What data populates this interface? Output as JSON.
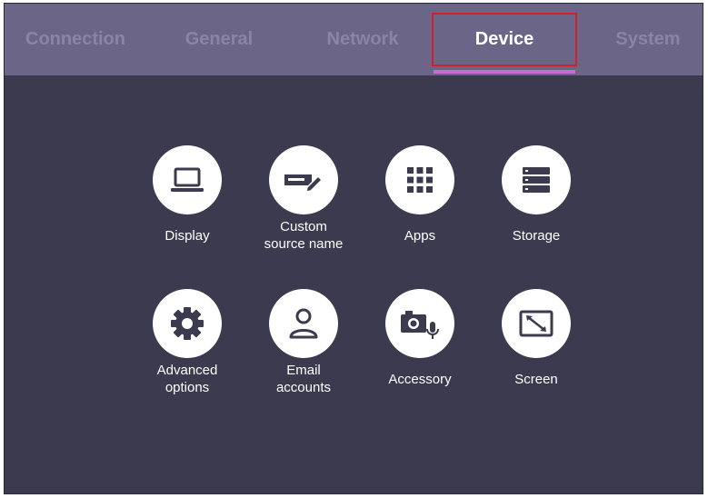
{
  "tabs": [
    {
      "label": "Connection",
      "active": false
    },
    {
      "label": "General",
      "active": false
    },
    {
      "label": "Network",
      "active": false
    },
    {
      "label": "Device",
      "active": true
    },
    {
      "label": "System",
      "active": false
    }
  ],
  "items": [
    {
      "label": "Display",
      "icon": "laptop-icon"
    },
    {
      "label": "Custom\nsource name",
      "icon": "source-rename-icon"
    },
    {
      "label": "Apps",
      "icon": "apps-grid-icon"
    },
    {
      "label": "Storage",
      "icon": "storage-icon"
    },
    {
      "label": "Advanced\noptions",
      "icon": "gear-icon"
    },
    {
      "label": "Email\naccounts",
      "icon": "user-icon"
    },
    {
      "label": "Accessory",
      "icon": "camera-mic-icon"
    },
    {
      "label": "Screen",
      "icon": "screen-resize-icon"
    }
  ],
  "colors": {
    "background": "#3c3a4e",
    "tabbar": "#6b6688",
    "inactive_tab_text": "#8a84a6",
    "active_indicator": "#c56bd6",
    "highlight_box": "#d0202a"
  }
}
